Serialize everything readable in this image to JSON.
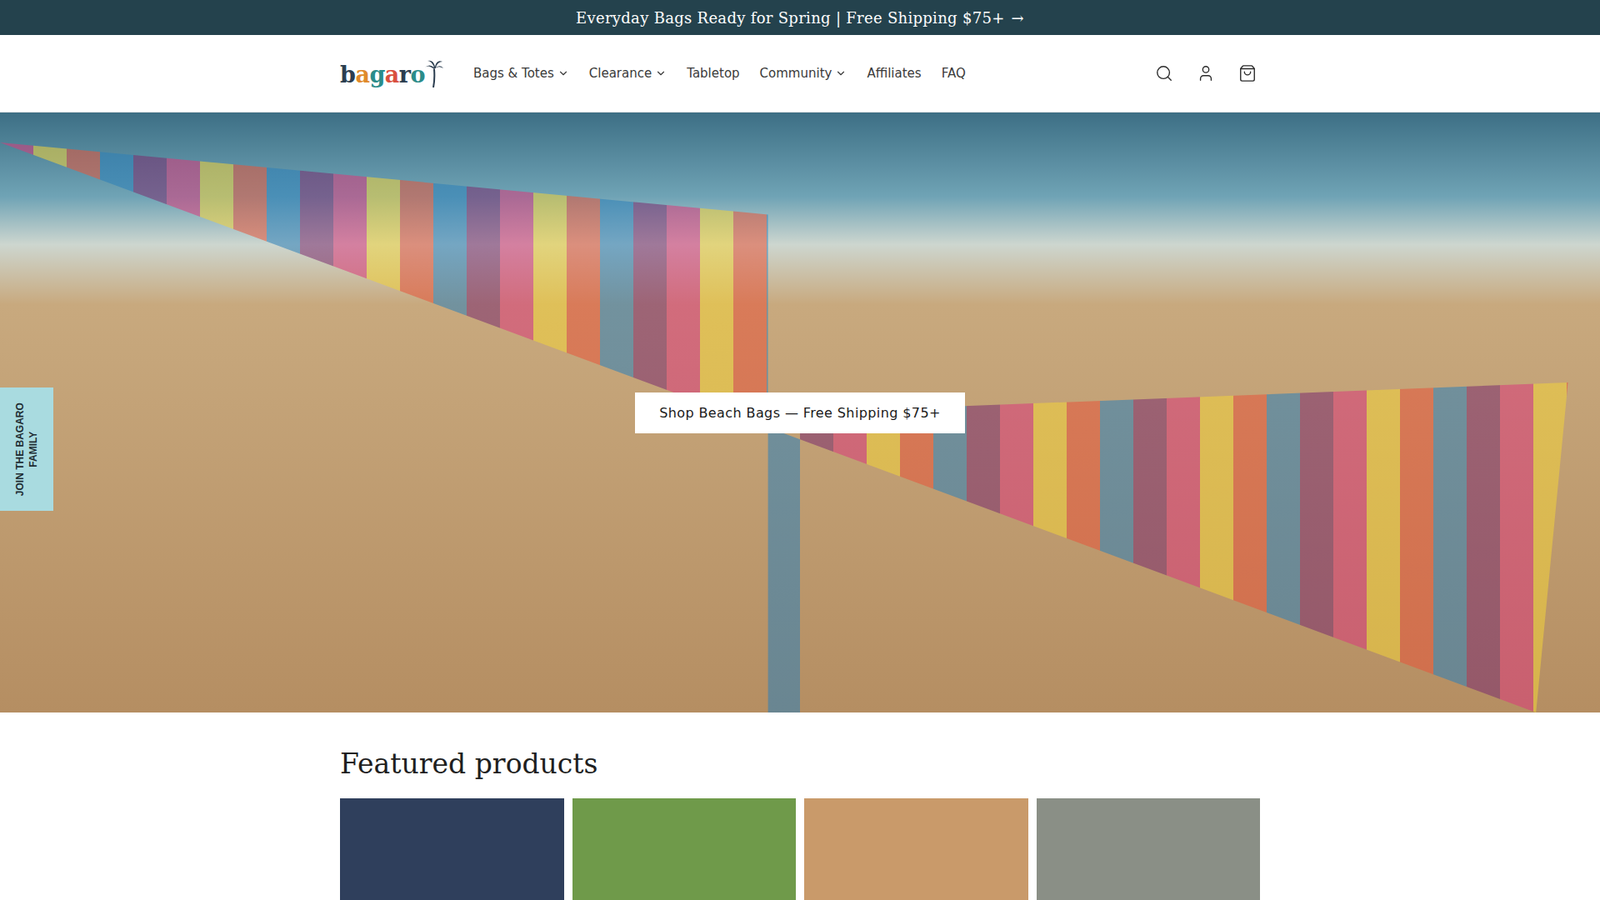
{
  "announcement": {
    "text": "Everyday Bags Ready for Spring | Free Shipping $75+",
    "arrow": "→"
  },
  "header": {
    "logo": "bagaro",
    "nav": [
      {
        "label": "Bags & Totes",
        "dropdown": true
      },
      {
        "label": "Clearance",
        "dropdown": true
      },
      {
        "label": "Tabletop",
        "dropdown": false
      },
      {
        "label": "Community",
        "dropdown": true
      },
      {
        "label": "Affiliates",
        "dropdown": false
      },
      {
        "label": "FAQ",
        "dropdown": false
      }
    ]
  },
  "hero": {
    "button": "Shop Beach Bags — Free Shipping $75+"
  },
  "side_tab": {
    "label": "JOIN THE BAGARO FAMILY"
  },
  "featured": {
    "title": "Featured products",
    "products": [
      {
        "color": "#2f3f5c"
      },
      {
        "color": "#6f9a4a"
      },
      {
        "color": "#c99a6a"
      },
      {
        "color": "#8a8f86"
      }
    ]
  }
}
